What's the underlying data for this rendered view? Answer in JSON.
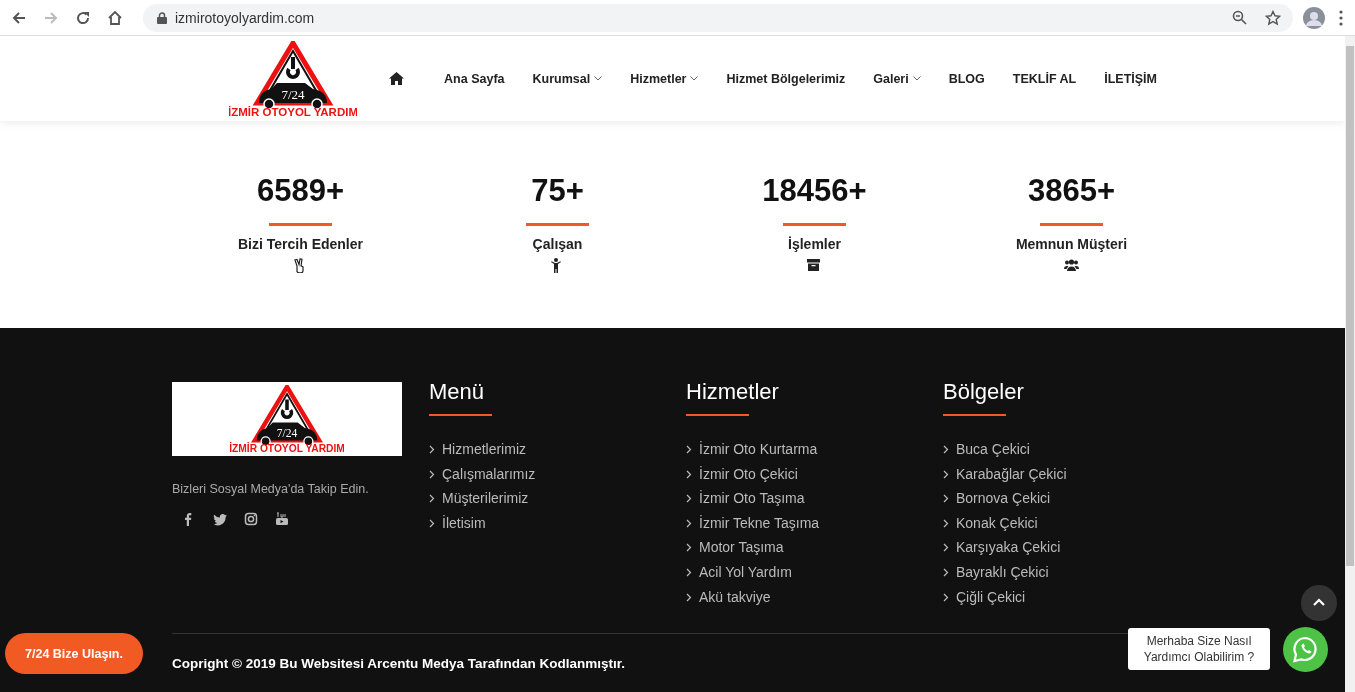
{
  "browser": {
    "url": "izmirotoyolyardim.com"
  },
  "header": {
    "logo": {
      "badge": "7/24",
      "name": "İZMİR OTOYOL YARDIM"
    },
    "nav": [
      {
        "kind": "home"
      },
      {
        "kind": "link",
        "label": "Ana Sayfa",
        "dropdown": false
      },
      {
        "kind": "link",
        "label": "Kurumsal",
        "dropdown": true
      },
      {
        "kind": "link",
        "label": "Hizmetler",
        "dropdown": true
      },
      {
        "kind": "link",
        "label": "Hizmet Bölgelerimiz",
        "dropdown": false
      },
      {
        "kind": "link",
        "label": "Galeri",
        "dropdown": true
      },
      {
        "kind": "link",
        "label": "BLOG",
        "dropdown": false
      },
      {
        "kind": "link",
        "label": "TEKLİF AL",
        "dropdown": false
      },
      {
        "kind": "link",
        "label": "İLETİŞİM",
        "dropdown": false
      }
    ]
  },
  "stats": [
    {
      "value": "6589+",
      "label": "Bizi Tercih Edenler",
      "kind": "peace"
    },
    {
      "value": "75+",
      "label": "Çalışan",
      "kind": "person"
    },
    {
      "value": "18456+",
      "label": "İşlemler",
      "kind": "archive"
    },
    {
      "value": "3865+",
      "label": "Memnun Müşteri",
      "kind": "users"
    }
  ],
  "footer": {
    "logo": {
      "badge": "7/24",
      "name": "İZMİR OTOYOL YARDIM"
    },
    "follow_text": "Bizleri Sosyal Medya'da Takip Edin.",
    "social": [
      {
        "kind": "facebook"
      },
      {
        "kind": "twitter"
      },
      {
        "kind": "instagram"
      },
      {
        "kind": "youtube"
      }
    ],
    "columns": [
      {
        "title": "Menü",
        "links": [
          "Hizmetlerimiz",
          "Çalışmalarımız",
          "Müşterilerimiz",
          "İletisim"
        ]
      },
      {
        "title": "Hizmetler",
        "links": [
          "İzmir Oto Kurtarma",
          "İzmir Oto Çekici",
          "İzmir Oto Taşıma",
          "İzmir Tekne Taşıma",
          "Motor Taşıma",
          "Acil Yol Yardım",
          "Akü takviye"
        ]
      },
      {
        "title": "Bölgeler",
        "links": [
          "Buca Çekici",
          "Karabağlar Çekici",
          "Bornova Çekici",
          "Konak Çekici",
          "Karşıyaka Çekici",
          "Bayraklı Çekici",
          "Çiğli Çekici"
        ]
      }
    ],
    "copyright": "Copright © 2019 Bu Websitesi Arcentu Medya Tarafından Kodlanmıştır."
  },
  "contact_button": "7/24 Bize Ulaşın.",
  "whatsapp": {
    "tooltip": "Merhaba Size Nasıl Yardımcı Olabilirim ?"
  }
}
